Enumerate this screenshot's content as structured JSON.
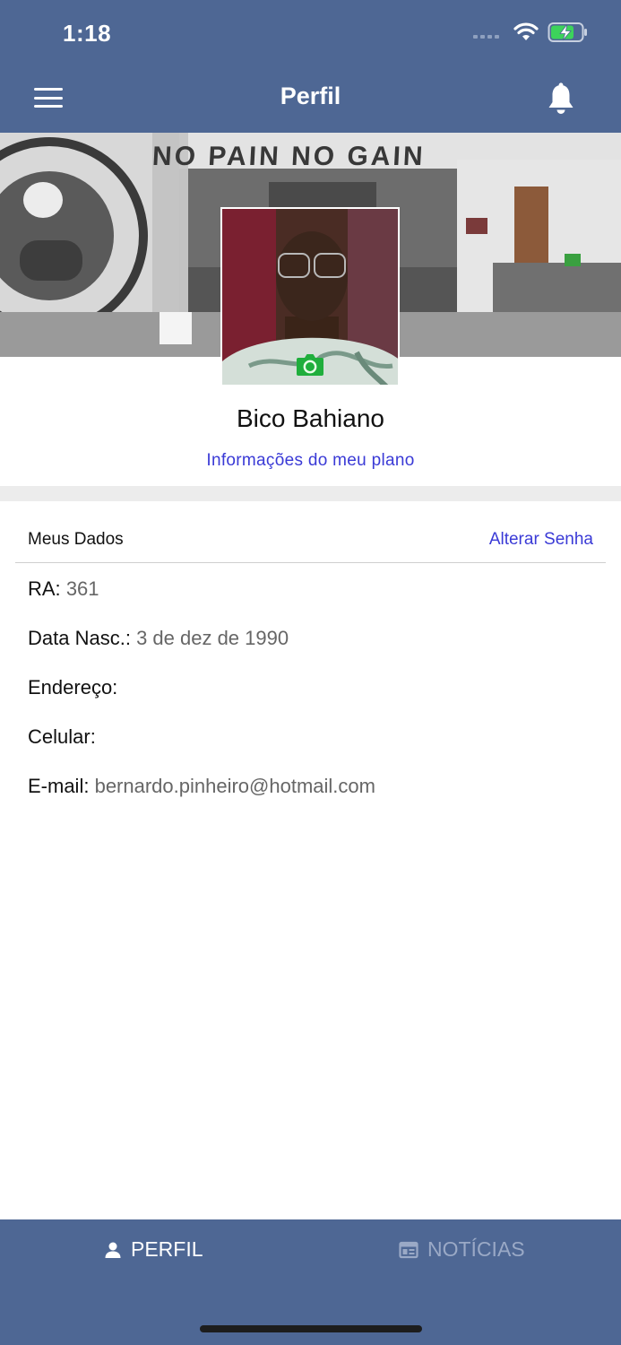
{
  "status_bar": {
    "time": "1:18"
  },
  "nav": {
    "title": "Perfil"
  },
  "cover": {
    "slogan": "NO PAIN  NO GAIN"
  },
  "profile": {
    "name": "Bico Bahiano",
    "plan_link": "Informações do meu plano"
  },
  "section": {
    "title": "Meus Dados",
    "change_password": "Alterar Senha"
  },
  "fields": [
    {
      "label": "RA:",
      "value": "361"
    },
    {
      "label": "Data Nasc.:",
      "value": "3 de dez de 1990"
    },
    {
      "label": "Endereço:",
      "value": ""
    },
    {
      "label": "Celular:",
      "value": ""
    },
    {
      "label": "E-mail:",
      "value": "bernardo.pinheiro@hotmail.com"
    }
  ],
  "tabs": [
    {
      "label": "PERFIL",
      "icon": "person-icon",
      "active": true
    },
    {
      "label": "NOTÍCIAS",
      "icon": "newspaper-icon",
      "active": false
    }
  ],
  "colors": {
    "header": "#4e6794",
    "link": "#3a3ad6",
    "camera_icon": "#1fae3c",
    "tab_inactive": "#9aa9c6"
  },
  "icons": {
    "menu": "hamburger-icon",
    "notifications": "bell-icon",
    "camera": "camera-icon",
    "wifi": "wifi-icon",
    "battery": "battery-charging-icon"
  }
}
